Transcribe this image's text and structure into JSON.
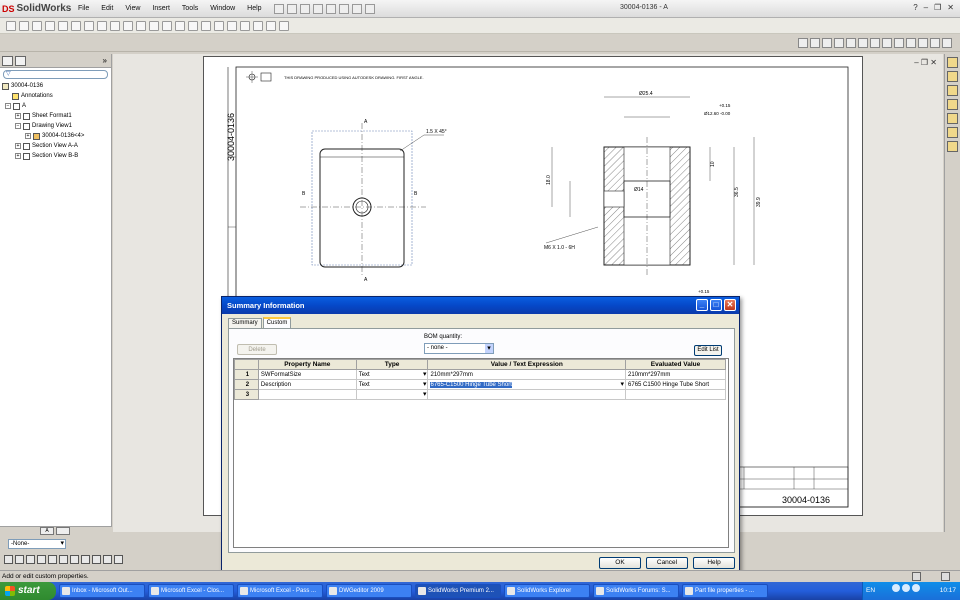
{
  "app": {
    "name": "SolidWorks",
    "document_title": "30004-0136 - A",
    "menu": [
      "File",
      "Edit",
      "View",
      "Insert",
      "Tools",
      "Window",
      "Help"
    ]
  },
  "tree": {
    "items": [
      {
        "label": "30004-0136",
        "indent": 0
      },
      {
        "label": "Annotations",
        "indent": 1
      },
      {
        "label": "A",
        "indent": 1
      },
      {
        "label": "Sheet Format1",
        "indent": 2
      },
      {
        "label": "Drawing View1",
        "indent": 2
      },
      {
        "label": "30004-0136<4>",
        "indent": 3
      },
      {
        "label": "Section View A-A",
        "indent": 2
      },
      {
        "label": "Section View B-B",
        "indent": 2
      }
    ],
    "config_select": "-None-"
  },
  "drawing": {
    "note": "THIS DRAWING PRODUCED USING AUTODESK DRAWING. FIRST ANGLE.",
    "side_title": "30004-0136",
    "title_block_number": "30004-0136",
    "detail_note": "1.5 X 45°",
    "section_label": "A",
    "section_label_b": "B",
    "dims": {
      "d1": "Ø25.4",
      "d2": "+0.15",
      "d3": "Ø12.60 -0.00",
      "d4": "10",
      "d5": "36.5",
      "d6": "39.9",
      "d7": "Ø14",
      "d8": "18.0",
      "d9": "M6 X 1.0 - 6H",
      "d10": "+0.15"
    }
  },
  "dialog": {
    "title": "Summary Information",
    "tabs": [
      "Summary",
      "Custom"
    ],
    "active_tab": "Custom",
    "delete_label": "Delete",
    "bom_label": "BOM quantity:",
    "bom_value": "- none -",
    "edit_list_label": "Edit List",
    "columns": [
      "Property Name",
      "Type",
      "Value / Text Expression",
      "Evaluated Value"
    ],
    "rows": [
      {
        "num": "1",
        "name": "SWFormatSize",
        "type": "Text",
        "value": "210mm*297mm",
        "evaluated": "210mm*297mm"
      },
      {
        "num": "2",
        "name": "Description",
        "type": "Text",
        "value": "6765-C1500 Hinge Tube Short",
        "evaluated": "6765 C1500 Hinge Tube Short"
      },
      {
        "num": "3",
        "name": "",
        "type": "",
        "value": "",
        "evaluated": ""
      }
    ],
    "ok_label": "OK",
    "cancel_label": "Cancel",
    "help_label": "Help"
  },
  "status": {
    "text": "Add or edit custom properties."
  },
  "taskbar": {
    "start_label": "start",
    "tasks": [
      "Inbox - Microsoft Out...",
      "Microsoft Excel - Clos...",
      "Microsoft Excel - Pass ...",
      "DWGeditor 2009",
      "SolidWorks Premium 2...",
      "SolidWorks Explorer",
      "SolidWorks Forums: S...",
      "Part file properties - ..."
    ],
    "active_task_index": 4,
    "language": "EN",
    "clock": "10:17"
  }
}
